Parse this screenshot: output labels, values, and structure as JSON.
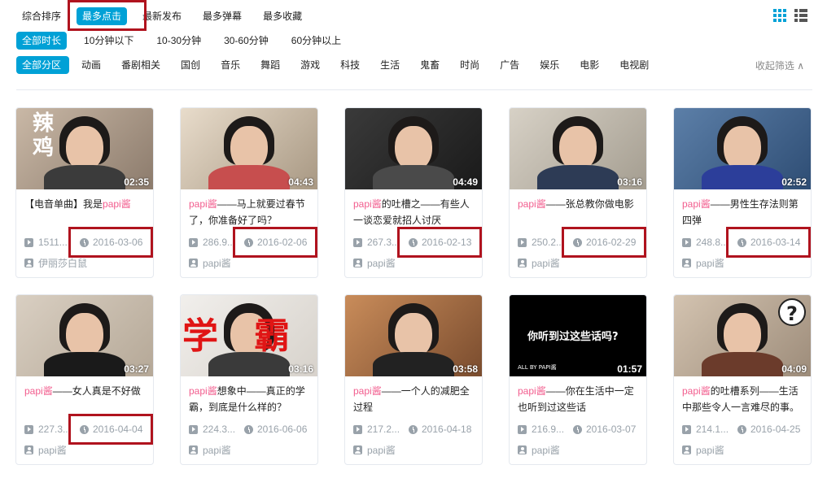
{
  "filters": {
    "sort": [
      "综合排序",
      "最多点击",
      "最新发布",
      "最多弹幕",
      "最多收藏"
    ],
    "sort_active": 1,
    "duration": [
      "全部时长",
      "10分钟以下",
      "10-30分钟",
      "30-60分钟",
      "60分钟以上"
    ],
    "duration_active": 0,
    "zones": [
      "全部分区",
      "动画",
      "番剧相关",
      "国创",
      "音乐",
      "舞蹈",
      "游戏",
      "科技",
      "生活",
      "鬼畜",
      "时尚",
      "广告",
      "娱乐",
      "电影",
      "电视剧"
    ],
    "zones_active": 0,
    "collapse_label": "收起筛选 ∧"
  },
  "view_icons": [
    "grid-view-icon",
    "list-view-icon"
  ],
  "accent_color": "#00a1d6",
  "highlight_color": "#b0131e",
  "author_color": "#f25d8e",
  "videos": [
    {
      "title_pre": "【电音单曲】我是",
      "title_hl": "papi酱",
      "title_post": "",
      "duration": "02:35",
      "plays": "1511...",
      "date": "2016-03-06",
      "up": "伊丽莎白鼠",
      "thumb_text": "辣\n鸡",
      "highlighted": true
    },
    {
      "title_pre": "",
      "title_hl": "papi酱",
      "title_post": "——马上就要过春节了，你准备好了吗？",
      "duration": "04:43",
      "plays": "286.9...",
      "date": "2016-02-06",
      "up": "papi酱",
      "thumb_text": "",
      "highlighted": true
    },
    {
      "title_pre": "",
      "title_hl": "papi酱",
      "title_post": "的吐槽之——有些人一谈恋爱就招人讨厌",
      "duration": "04:49",
      "plays": "267.3...",
      "date": "2016-02-13",
      "up": "papi酱",
      "thumb_text": "",
      "highlighted": true
    },
    {
      "title_pre": "",
      "title_hl": "papi酱",
      "title_post": "——张总教你做电影",
      "duration": "03:16",
      "plays": "250.2...",
      "date": "2016-02-29",
      "up": "papi酱",
      "thumb_text": "",
      "highlighted": true
    },
    {
      "title_pre": "",
      "title_hl": "papi酱",
      "title_post": "——男性生存法则第四弹",
      "duration": "02:52",
      "plays": "248.8...",
      "date": "2016-03-14",
      "up": "papi酱",
      "thumb_text": "",
      "highlighted": true
    },
    {
      "title_pre": "",
      "title_hl": "papi酱",
      "title_post": "——女人真是不好做",
      "duration": "03:27",
      "plays": "227.3...",
      "date": "2016-04-04",
      "up": "papi酱",
      "thumb_text": "",
      "highlighted": true
    },
    {
      "title_pre": "",
      "title_hl": "papi酱",
      "title_post": "想象中——真正的学霸，到底是什么样的？",
      "duration": "03:16",
      "plays": "224.3...",
      "date": "2016-06-06",
      "up": "papi酱",
      "thumb_text": "学　霸",
      "highlighted": false
    },
    {
      "title_pre": "",
      "title_hl": "papi酱",
      "title_post": "——一个人的减肥全过程",
      "duration": "03:58",
      "plays": "217.2...",
      "date": "2016-04-18",
      "up": "papi酱",
      "thumb_text": "",
      "highlighted": false
    },
    {
      "title_pre": "",
      "title_hl": "papi酱",
      "title_post": "——你在生活中一定也听到过这些话",
      "duration": "01:57",
      "plays": "216.9...",
      "date": "2016-03-07",
      "up": "papi酱",
      "thumb_text": "你听到过这些话吗?",
      "thumb_sub": "ALL BY PAPI酱",
      "highlighted": false
    },
    {
      "title_pre": "",
      "title_hl": "papi酱",
      "title_post": "的吐槽系列——生活中那些令人一言难尽的事。",
      "duration": "04:09",
      "plays": "214.1...",
      "date": "2016-04-25",
      "up": "papi酱",
      "thumb_text": "?",
      "highlighted": false
    }
  ]
}
